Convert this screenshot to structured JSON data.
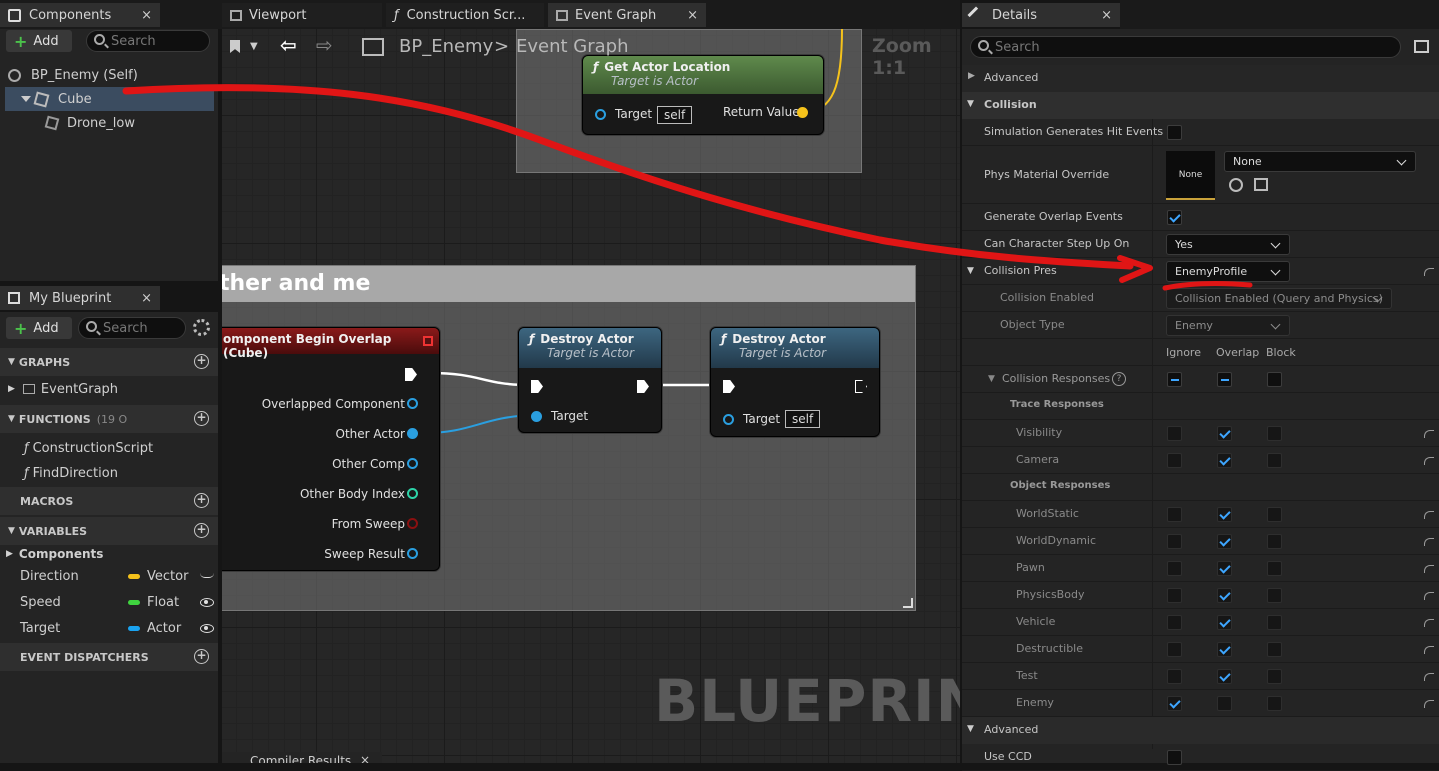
{
  "components_panel": {
    "tab_title": "Components",
    "close": "×",
    "add_label": "Add",
    "search_placeholder": "Search",
    "tree": [
      {
        "label": "BP_Enemy (Self)"
      },
      {
        "label": "Cube"
      },
      {
        "label": "Drone_low"
      }
    ]
  },
  "editor_tabs": [
    {
      "label": "Viewport"
    },
    {
      "label": "Construction Scr..."
    },
    {
      "label": "Event Graph"
    }
  ],
  "editor_tab_close": "×",
  "graph_toolbar": {
    "breadcrumb_root": "BP_Enemy",
    "breadcrumb_sep": ">",
    "breadcrumb_current": "Event Graph",
    "zoom": "Zoom 1:1"
  },
  "my_blueprint": {
    "tab_title": "My Blueprint",
    "close": "×",
    "add_label": "Add",
    "search_placeholder": "Search",
    "sections": {
      "graphs": "GRAPHS",
      "functions": "FUNCTIONS",
      "functions_count": "(19 O",
      "macros": "MACROS",
      "variables": "VARIABLES",
      "dispatchers": "EVENT DISPATCHERS"
    },
    "graphs": [
      "EventGraph"
    ],
    "functions": [
      "ConstructionScript",
      "FindDirection"
    ],
    "var_category": "Components",
    "variables": [
      {
        "name": "Direction",
        "type": "Vector",
        "color": "#f5c21b"
      },
      {
        "name": "Speed",
        "type": "Float",
        "color": "#3fd43f"
      },
      {
        "name": "Target",
        "type": "Actor",
        "color": "#1aa3f0"
      }
    ]
  },
  "graph": {
    "comment_title": "ther and me",
    "watermark": "BLUEPRINT",
    "get_location": {
      "title": "Get Actor Location",
      "subtitle": "Target is Actor",
      "target": "Target",
      "self": "self",
      "return": "Return Value"
    },
    "overlap_event": {
      "title": "omponent Begin Overlap (Cube)",
      "pins": [
        "Overlapped Component",
        "Other Actor",
        "Other Comp",
        "Other Body Index",
        "From Sweep",
        "Sweep Result"
      ]
    },
    "destroy1": {
      "title": "Destroy Actor",
      "subtitle": "Target is Actor",
      "target": "Target"
    },
    "destroy2": {
      "title": "Destroy Actor",
      "subtitle": "Target is Actor",
      "target": "Target",
      "self": "self"
    },
    "bottom_tab": "Compiler Results",
    "bottom_tab_close": "×"
  },
  "details": {
    "tab_title": "Details",
    "close": "×",
    "search_placeholder": "Search",
    "advanced_top": "Advanced",
    "collision_cat": "Collision",
    "sim_hit": "Simulation Generates Hit Events",
    "phys_mat": "Phys Material Override",
    "phys_thumb": "None",
    "phys_value": "None",
    "gen_overlap": "Generate Overlap Events",
    "step_up": "Can Character Step Up On",
    "step_up_value": "Yes",
    "collision_presets": "Collision Pres",
    "collision_presets_value": "EnemyProfile",
    "collision_enabled": "Collision Enabled",
    "collision_enabled_value": "Collision Enabled (Query and Physics)",
    "object_type": "Object Type",
    "object_type_value": "Enemy",
    "col_headers": [
      "Ignore",
      "Overlap",
      "Block"
    ],
    "collision_responses": "Collision Responses",
    "help": "?",
    "trace_responses": "Trace Responses",
    "trace_items": [
      {
        "name": "Visibility",
        "state": "overlap"
      },
      {
        "name": "Camera",
        "state": "overlap"
      }
    ],
    "object_responses": "Object Responses",
    "object_items": [
      {
        "name": "WorldStatic",
        "state": "overlap"
      },
      {
        "name": "WorldDynamic",
        "state": "overlap"
      },
      {
        "name": "Pawn",
        "state": "overlap"
      },
      {
        "name": "PhysicsBody",
        "state": "overlap"
      },
      {
        "name": "Vehicle",
        "state": "overlap"
      },
      {
        "name": "Destructible",
        "state": "overlap"
      },
      {
        "name": "Test",
        "state": "overlap"
      },
      {
        "name": "Enemy",
        "state": "ignore"
      }
    ],
    "advanced_bottom": "Advanced",
    "use_ccd": "Use CCD"
  }
}
